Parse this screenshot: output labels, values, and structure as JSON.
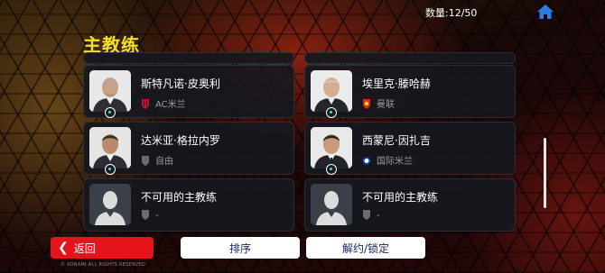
{
  "header": {
    "title": "主教练",
    "count": "数量:12/50"
  },
  "cards": [
    {
      "name": "",
      "club": ""
    },
    {
      "name": "",
      "club": ""
    },
    {
      "name": "斯特凡诺·皮奥利",
      "club": "AC米兰",
      "club_icon": "ac-milan-crest-icon"
    },
    {
      "name": "埃里克·滕哈赫",
      "club": "曼联",
      "club_icon": "man-united-crest-icon"
    },
    {
      "name": "达米亚·格拉内罗",
      "club": "自由",
      "club_icon": "shield-icon"
    },
    {
      "name": "西蒙尼·因扎吉",
      "club": "国际米兰",
      "club_icon": "inter-crest-icon"
    },
    {
      "name": "不可用的主教练",
      "club": "-",
      "club_icon": "shield-icon"
    },
    {
      "name": "不可用的主教练",
      "club": "-",
      "club_icon": "shield-icon"
    }
  ],
  "footer": {
    "back_label": "返回",
    "sort_label": "排序",
    "lock_label": "解约/锁定",
    "copyright": "© KONAMI ALL RIGHTS RESERVED"
  },
  "colors": {
    "title": "#f4e02c",
    "back_button": "#e4141b",
    "button_text": "#1b2660"
  }
}
